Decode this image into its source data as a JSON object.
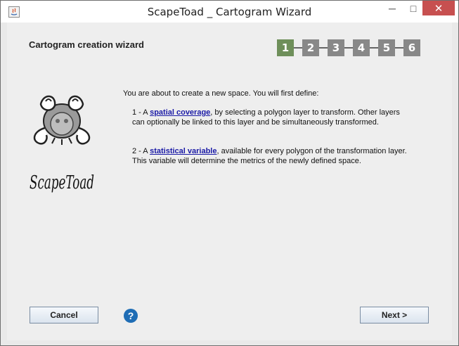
{
  "window": {
    "title": "ScapeToad _ Cartogram Wizard",
    "controls": {
      "minimize": "─",
      "maximize": "□",
      "close": "✕"
    }
  },
  "wizard": {
    "heading": "Cartogram creation wizard",
    "steps": [
      "1",
      "2",
      "3",
      "4",
      "5",
      "6"
    ],
    "active_step": 1,
    "logo": {
      "icon": "scapetoad-logo",
      "text": "ScapeToad"
    },
    "intro": "You are about to create a new space. You will first define:",
    "item1": {
      "prefix": "1 - A ",
      "link": "spatial coverage",
      "suffix_line1": ", by selecting a polygon layer to transform. Other layers",
      "line2": "can optionally be linked to this layer and be simultaneously transformed."
    },
    "item2": {
      "prefix": "2 - A ",
      "link": "statistical variable",
      "suffix_line1": ", available for every polygon of the transformation layer.",
      "line2": "This variable will determine the metrics of the newly defined space."
    }
  },
  "buttons": {
    "cancel": "Cancel",
    "help": "?",
    "next": "Next >"
  },
  "colors": {
    "active_step": "#6e8f5a",
    "inactive_step": "#888888",
    "link": "#1a1aa6",
    "help": "#1f6db5",
    "close_button": "#c75050"
  }
}
